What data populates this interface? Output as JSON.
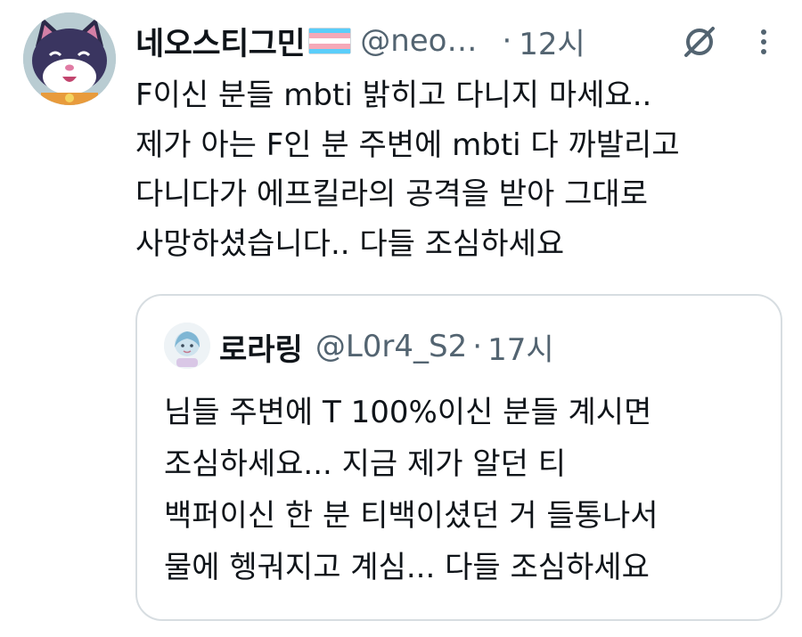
{
  "tweet": {
    "display_name": "네오스티그민",
    "handle": "@neo…",
    "separator": "·",
    "time": "12시",
    "text_lines": [
      "F이신 분들 mbti 밝히고 다니지 마세요..",
      "제가 아는 F인 분 주변에 mbti 다 까발리고",
      "다니다가 에프킬라의 공격을 받아 그대로",
      "사망하셨습니다.. 다들 조심하세요"
    ],
    "icons": {
      "avatar": "cat-avatar",
      "flag": "transgender-flag-icon",
      "ban": "ban-icon",
      "more": "more-vertical-icon"
    }
  },
  "quote": {
    "display_name": "로라링",
    "handle": "@L0r4_S2",
    "separator": "·",
    "time": "17시",
    "text_lines": [
      "님들 주변에 T 100%이신 분들 계시면",
      "조심하세요... 지금 제가 알던 티",
      "백퍼이신 한 분 티백이셨던 거 들통나서",
      "물에 헹궈지고 계심... 다들 조심하세요"
    ]
  },
  "colors": {
    "text_primary": "#0f1419",
    "text_secondary": "#536471",
    "border": "#d7dde1",
    "flag_blue": "#5bcefa",
    "flag_pink": "#f5a9b8",
    "flag_white": "#ffffff"
  }
}
